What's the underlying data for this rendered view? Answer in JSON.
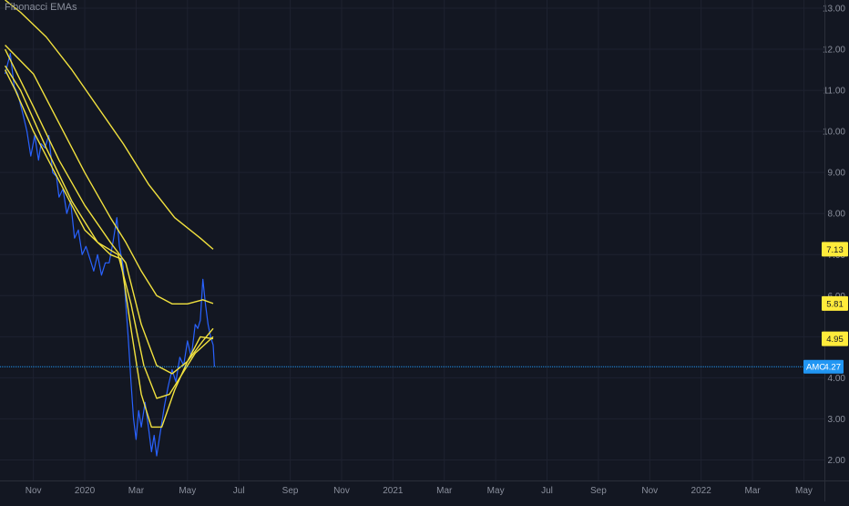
{
  "colors": {
    "background": "#131722",
    "grid": "#1e2230",
    "price_line": "#2962ff",
    "ema": "#f2e23e",
    "axis_text": "#8a8f9c",
    "last_price_line": "#2196f3",
    "last_price_badge": "#2196f3",
    "ema_badge": "#ffeb3b"
  },
  "indicator": {
    "label": "Fibonacci EMAs"
  },
  "symbol": {
    "ticker": "AMC",
    "last_price": "4.27"
  },
  "ema_badges": [
    "7.13",
    "5.81",
    "4.95"
  ],
  "chart_data": {
    "type": "line",
    "title": "",
    "xlabel": "",
    "ylabel": "",
    "ylim": [
      1.5,
      13.2
    ],
    "y_ticks": [
      "2.00",
      "3.00",
      "4.00",
      "5.00",
      "6.00",
      "7.00",
      "8.00",
      "9.00",
      "10.00",
      "11.00",
      "12.00",
      "13.00"
    ],
    "x_ticks": [
      "Nov",
      "2020",
      "Mar",
      "May",
      "Jul",
      "Sep",
      "Nov",
      "2021",
      "Mar",
      "May",
      "Jul",
      "Sep",
      "Nov",
      "2022",
      "Mar",
      "May"
    ],
    "x_unit": "month index (Oct 2019 = 0)",
    "x_range": [
      -0.3,
      31.8
    ],
    "series": [
      {
        "values": [
          [
            -0.1,
            11.4
          ],
          [
            0.1,
            11.9
          ],
          [
            0.25,
            11.1
          ],
          [
            0.4,
            10.9
          ],
          [
            0.6,
            10.4
          ],
          [
            0.75,
            10.0
          ],
          [
            0.9,
            9.4
          ],
          [
            1.05,
            9.9
          ],
          [
            1.2,
            9.3
          ],
          [
            1.3,
            9.7
          ],
          [
            1.45,
            9.6
          ],
          [
            1.6,
            9.9
          ],
          [
            1.75,
            9.0
          ],
          [
            1.9,
            8.9
          ],
          [
            2.0,
            8.4
          ],
          [
            2.15,
            8.6
          ],
          [
            2.3,
            8.0
          ],
          [
            2.45,
            8.3
          ],
          [
            2.6,
            7.4
          ],
          [
            2.75,
            7.6
          ],
          [
            2.9,
            7.0
          ],
          [
            3.05,
            7.2
          ],
          [
            3.2,
            6.9
          ],
          [
            3.35,
            6.6
          ],
          [
            3.5,
            7.0
          ],
          [
            3.65,
            6.5
          ],
          [
            3.8,
            6.8
          ],
          [
            3.95,
            6.8
          ],
          [
            4.1,
            7.3
          ],
          [
            4.25,
            7.9
          ],
          [
            4.35,
            7.2
          ],
          [
            4.5,
            6.7
          ],
          [
            4.6,
            5.8
          ],
          [
            4.7,
            4.9
          ],
          [
            4.8,
            3.9
          ],
          [
            4.9,
            3.0
          ],
          [
            5.0,
            2.5
          ],
          [
            5.1,
            3.2
          ],
          [
            5.2,
            2.8
          ],
          [
            5.35,
            3.4
          ],
          [
            5.5,
            2.7
          ],
          [
            5.6,
            2.2
          ],
          [
            5.7,
            2.6
          ],
          [
            5.8,
            2.1
          ],
          [
            5.95,
            2.7
          ],
          [
            6.1,
            3.3
          ],
          [
            6.25,
            3.8
          ],
          [
            6.4,
            4.2
          ],
          [
            6.55,
            3.9
          ],
          [
            6.7,
            4.5
          ],
          [
            6.85,
            4.3
          ],
          [
            7.0,
            4.9
          ],
          [
            7.15,
            4.5
          ],
          [
            7.3,
            5.3
          ],
          [
            7.4,
            5.2
          ],
          [
            7.5,
            5.4
          ],
          [
            7.6,
            6.4
          ],
          [
            7.7,
            5.8
          ],
          [
            7.8,
            5.3
          ],
          [
            7.9,
            5.0
          ],
          [
            8.0,
            4.8
          ],
          [
            8.05,
            4.27
          ]
        ]
      },
      {
        "values": [
          [
            -0.1,
            11.5
          ],
          [
            0.3,
            11.0
          ],
          [
            1.0,
            10.0
          ],
          [
            2.0,
            8.8
          ],
          [
            3.0,
            7.6
          ],
          [
            4.0,
            7.0
          ],
          [
            4.4,
            6.9
          ],
          [
            4.8,
            5.2
          ],
          [
            5.2,
            3.6
          ],
          [
            5.6,
            2.8
          ],
          [
            6.0,
            2.8
          ],
          [
            6.5,
            3.7
          ],
          [
            7.0,
            4.4
          ],
          [
            7.5,
            5.0
          ],
          [
            8.0,
            4.95
          ]
        ]
      },
      {
        "values": [
          [
            -0.1,
            11.6
          ],
          [
            0.5,
            11.0
          ],
          [
            1.5,
            9.6
          ],
          [
            2.5,
            8.3
          ],
          [
            3.5,
            7.3
          ],
          [
            4.3,
            7.0
          ],
          [
            4.8,
            5.8
          ],
          [
            5.3,
            4.3
          ],
          [
            5.8,
            3.5
          ],
          [
            6.3,
            3.6
          ],
          [
            6.8,
            4.1
          ],
          [
            7.3,
            4.6
          ],
          [
            8.0,
            5.0
          ]
        ]
      },
      {
        "values": [
          [
            -0.1,
            12.0
          ],
          [
            1.0,
            10.6
          ],
          [
            2.0,
            9.3
          ],
          [
            3.0,
            8.2
          ],
          [
            4.0,
            7.3
          ],
          [
            4.6,
            6.8
          ],
          [
            5.2,
            5.3
          ],
          [
            5.8,
            4.3
          ],
          [
            6.4,
            4.1
          ],
          [
            7.0,
            4.4
          ],
          [
            7.6,
            4.9
          ],
          [
            8.0,
            5.2
          ]
        ]
      },
      {
        "values": [
          [
            -0.1,
            12.1
          ],
          [
            1.0,
            11.4
          ],
          [
            2.0,
            10.2
          ],
          [
            3.0,
            9.0
          ],
          [
            4.0,
            7.9
          ],
          [
            4.6,
            7.3
          ],
          [
            5.2,
            6.6
          ],
          [
            5.8,
            6.0
          ],
          [
            6.4,
            5.8
          ],
          [
            7.0,
            5.8
          ],
          [
            7.6,
            5.9
          ],
          [
            8.0,
            5.81
          ]
        ]
      },
      {
        "values": [
          [
            -0.1,
            13.2
          ],
          [
            0.5,
            12.9
          ],
          [
            1.5,
            12.3
          ],
          [
            2.5,
            11.5
          ],
          [
            3.5,
            10.6
          ],
          [
            4.5,
            9.7
          ],
          [
            5.5,
            8.7
          ],
          [
            6.5,
            7.9
          ],
          [
            7.5,
            7.4
          ],
          [
            8.0,
            7.13
          ]
        ]
      }
    ]
  }
}
